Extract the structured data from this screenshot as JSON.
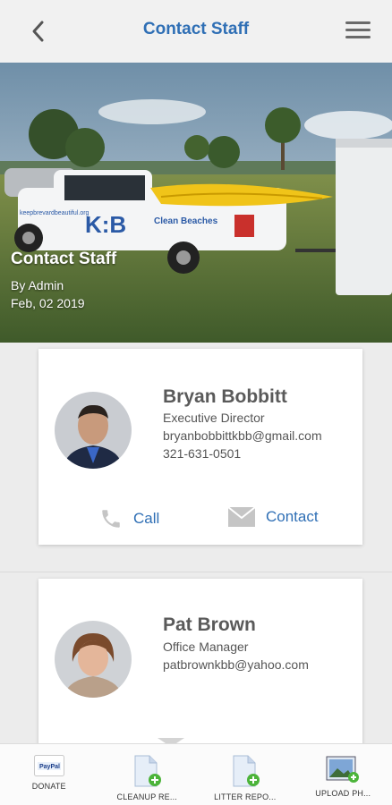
{
  "header": {
    "title": "Contact Staff",
    "back_icon": "chevron-left-icon",
    "menu_icon": "hamburger-menu-icon"
  },
  "hero": {
    "title": "Contact Staff",
    "author": "By Admin",
    "date": "Feb, 02 2019",
    "truck_logo": "K:B",
    "truck_text": "Clean Beaches",
    "truck_url": "keepbrevardbeautiful.org"
  },
  "staff": [
    {
      "name": "Bryan Bobbitt",
      "role": "Executive Director",
      "email": "bryanbobbittkbb@gmail.com",
      "phone": "321-631-0501",
      "call_label": "Call",
      "contact_label": "Contact"
    },
    {
      "name": "Pat Brown",
      "role": "Office Manager",
      "email": "patbrownkbb@yahoo.com"
    }
  ],
  "bottom_nav": [
    {
      "label": "DONATE",
      "icon": "paypal-icon"
    },
    {
      "label": "CLEANUP RE...",
      "icon": "add-document-icon"
    },
    {
      "label": "LITTER REPO...",
      "icon": "add-document-icon"
    },
    {
      "label": "UPLOAD PH...",
      "icon": "add-photo-icon"
    }
  ],
  "colors": {
    "accent": "#2f6fb5",
    "header_bg": "#f1f1f1",
    "page_bg": "#ececec"
  }
}
